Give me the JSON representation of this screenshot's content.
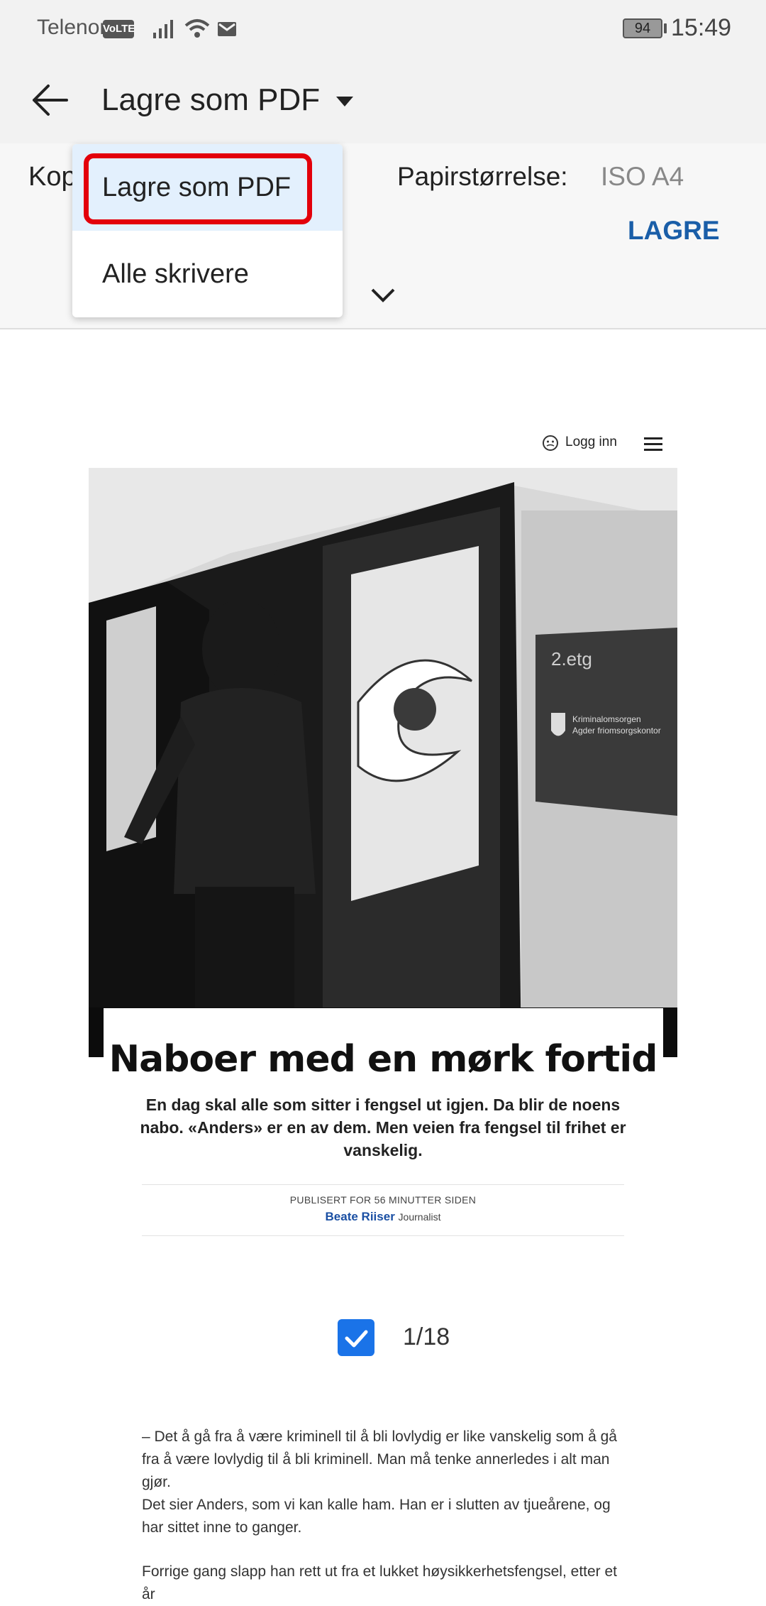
{
  "statusbar": {
    "carrier": "Telenor",
    "volte": "VoLTE",
    "battery": "94",
    "time": "15:49"
  },
  "appbar": {
    "title": "Lagre som PDF"
  },
  "settings": {
    "copies_label_partial": "Kop",
    "paper_label": "Papirstørrelse:",
    "paper_value": "ISO A4",
    "save_button": "LAGRE"
  },
  "dropdown": {
    "items": [
      {
        "label": "Lagre som PDF",
        "selected": true
      },
      {
        "label": "Alle skrivere",
        "selected": false
      }
    ]
  },
  "preview": {
    "site": {
      "login": "Logg inn"
    },
    "photo": {
      "sign_floor": "2.etg",
      "sign_line1": "Kriminalomsorgen",
      "sign_line2": "Agder friomsorgskontor"
    },
    "headline": "Naboer med en mørk fortid",
    "lead": "En dag skal alle som sitter i fengsel ut igjen. Da blir de noens nabo. «Anders» er en av dem. Men veien fra fengsel til frihet er vanskelig.",
    "published": "PUBLISERT FOR 56 MINUTTER SIDEN",
    "author_name": "Beate Riiser",
    "author_role": "Journalist",
    "page_indicator": "1/18",
    "paragraphs": [
      "– Det å gå fra å være kriminell til å bli lovlydig er like vanskelig som å gå fra å være lovlydig til å bli kriminell. Man må tenke annerledes i alt man gjør.",
      "Det sier Anders, som vi kan kalle ham. Han er i slutten av tjueårene, og har sittet inne to ganger.",
      "Forrige gang slapp han rett ut fra et lukket høysikkerhetsfengsel, etter et år"
    ]
  }
}
